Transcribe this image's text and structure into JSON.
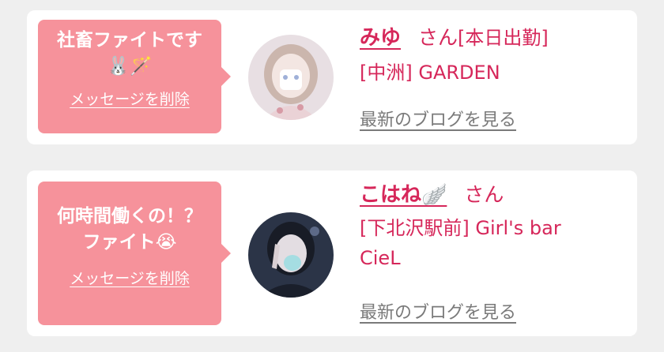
{
  "cards": [
    {
      "message": "社畜ファイトです\n🐰🪄",
      "delete_label": "メッセージを削除",
      "name": "みゆ",
      "honorific": "さん",
      "status": "[本日出勤]",
      "shop_line": "[中洲] GARDEN",
      "blog_label": "最新のブログを見る"
    },
    {
      "message": "何時間働くの！？\nファイト😭",
      "delete_label": "メッセージを削除",
      "name": "こはね🪽",
      "honorific": "さん",
      "shop_line": "[下北沢駅前] Girl's bar",
      "shop_line2": "CieL",
      "blog_label": "最新のブログを見る"
    }
  ],
  "colors": {
    "bubble": "#f6929b",
    "accent": "#d6275a",
    "link_gray": "#7a7a7a",
    "page_bg": "#efefef"
  }
}
